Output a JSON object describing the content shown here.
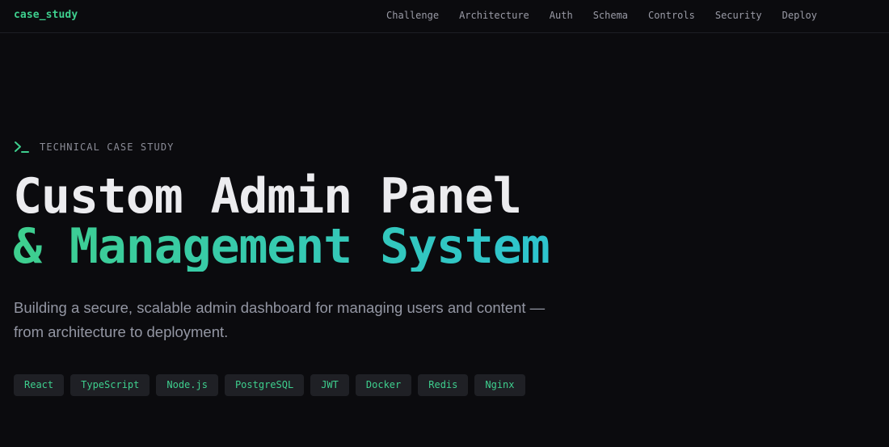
{
  "nav": {
    "brand": "case_study",
    "links": [
      "Challenge",
      "Architecture",
      "Auth",
      "Schema",
      "Controls",
      "Security",
      "Deploy"
    ]
  },
  "hero": {
    "eyebrow_icon": "terminal-prompt-icon",
    "eyebrow": "TECHNICAL CASE STUDY",
    "title_line1": "Custom Admin Panel",
    "title_line2": "& Management System",
    "subtitle": "Building a secure, scalable admin dashboard for managing users and content — from architecture to deployment.",
    "tags": [
      "React",
      "TypeScript",
      "Node.js",
      "PostgreSQL",
      "JWT",
      "Docker",
      "Redis",
      "Nginx"
    ]
  },
  "colors": {
    "background": "#0b0b0e",
    "accent_green": "#3ecf8e",
    "accent_teal": "#2ec4cf",
    "tag_background": "#1f2025",
    "muted_text": "#9396a3"
  }
}
